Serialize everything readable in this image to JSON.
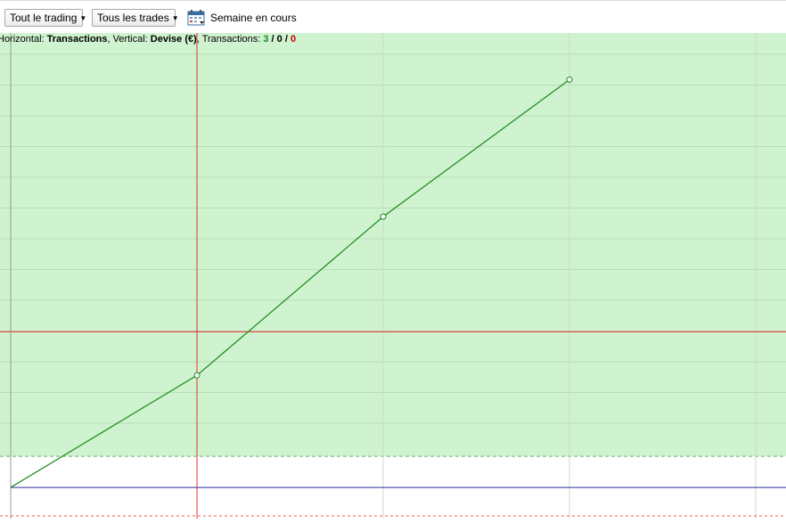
{
  "toolbar": {
    "trading_filter": "Tout le trading",
    "trades_filter": "Tous les trades",
    "period_label": "Semaine en cours",
    "calendar_icon": "calendar-icon",
    "caret_icon": "caret-down-icon"
  },
  "chart_info": {
    "horizontal_label": "Horizontal: ",
    "horizontal_value": "Transactions",
    "vertical_label": ", Vertical: ",
    "vertical_value": "Devise (€)",
    "transactions_label": ", Transactions: ",
    "wins": "3",
    "sep1": " / ",
    "breakeven": "0",
    "sep2": " / ",
    "losses": "0"
  },
  "colors": {
    "profit_zone": "#cff2cf",
    "grid": "#b9dcb9",
    "line": "#1a8a1a",
    "cursor": "#e83030",
    "baseline": "#2a2a9a"
  },
  "chart_data": {
    "type": "line",
    "title": "",
    "xlabel": "Transactions",
    "ylabel": "Devise (€)",
    "x": [
      0,
      1,
      2,
      3
    ],
    "series": [
      {
        "values": [
          0,
          36,
          87,
          131
        ]
      }
    ],
    "grid": true,
    "xlim": [
      0,
      4
    ],
    "ylim": [
      -10,
      146
    ],
    "profit_zone_from": 10,
    "cursor_x": 1,
    "cursor_y": 50
  }
}
